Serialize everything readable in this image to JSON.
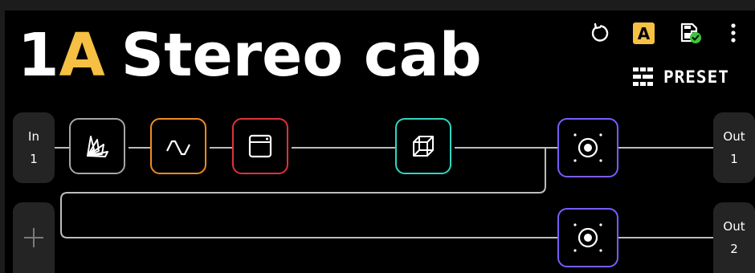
{
  "preset": {
    "slot": "1",
    "bank": "A",
    "name": "Stereo cab"
  },
  "toolbar": {
    "snapshot_label": "A",
    "preset_label": "PRESET",
    "icons": [
      "undo-icon",
      "snapshot-badge",
      "save-check-icon",
      "more-vertical-icon",
      "grid-icon"
    ]
  },
  "signal_chain": {
    "inputs": [
      {
        "line1": "In",
        "line2": "1"
      }
    ],
    "outputs": [
      {
        "line1": "Out",
        "line2": "1"
      },
      {
        "line1": "Out",
        "line2": "2"
      }
    ],
    "add_input_label": "+",
    "blocks": [
      {
        "icon": "dynamics-icon",
        "color": "#a6a6a6"
      },
      {
        "icon": "eq-filter-icon",
        "color": "#f08a24"
      },
      {
        "icon": "amp-icon",
        "color": "#e0313a"
      },
      {
        "icon": "cube-icon",
        "color": "#2fd6c1"
      },
      {
        "icon": "speaker-cab-icon",
        "color": "#7a5cff",
        "row": 1
      },
      {
        "icon": "speaker-cab-icon",
        "color": "#7a5cff",
        "row": 2
      }
    ]
  },
  "colors": {
    "accent_bank": "#f5c043",
    "save_ok": "#3cc83c"
  }
}
